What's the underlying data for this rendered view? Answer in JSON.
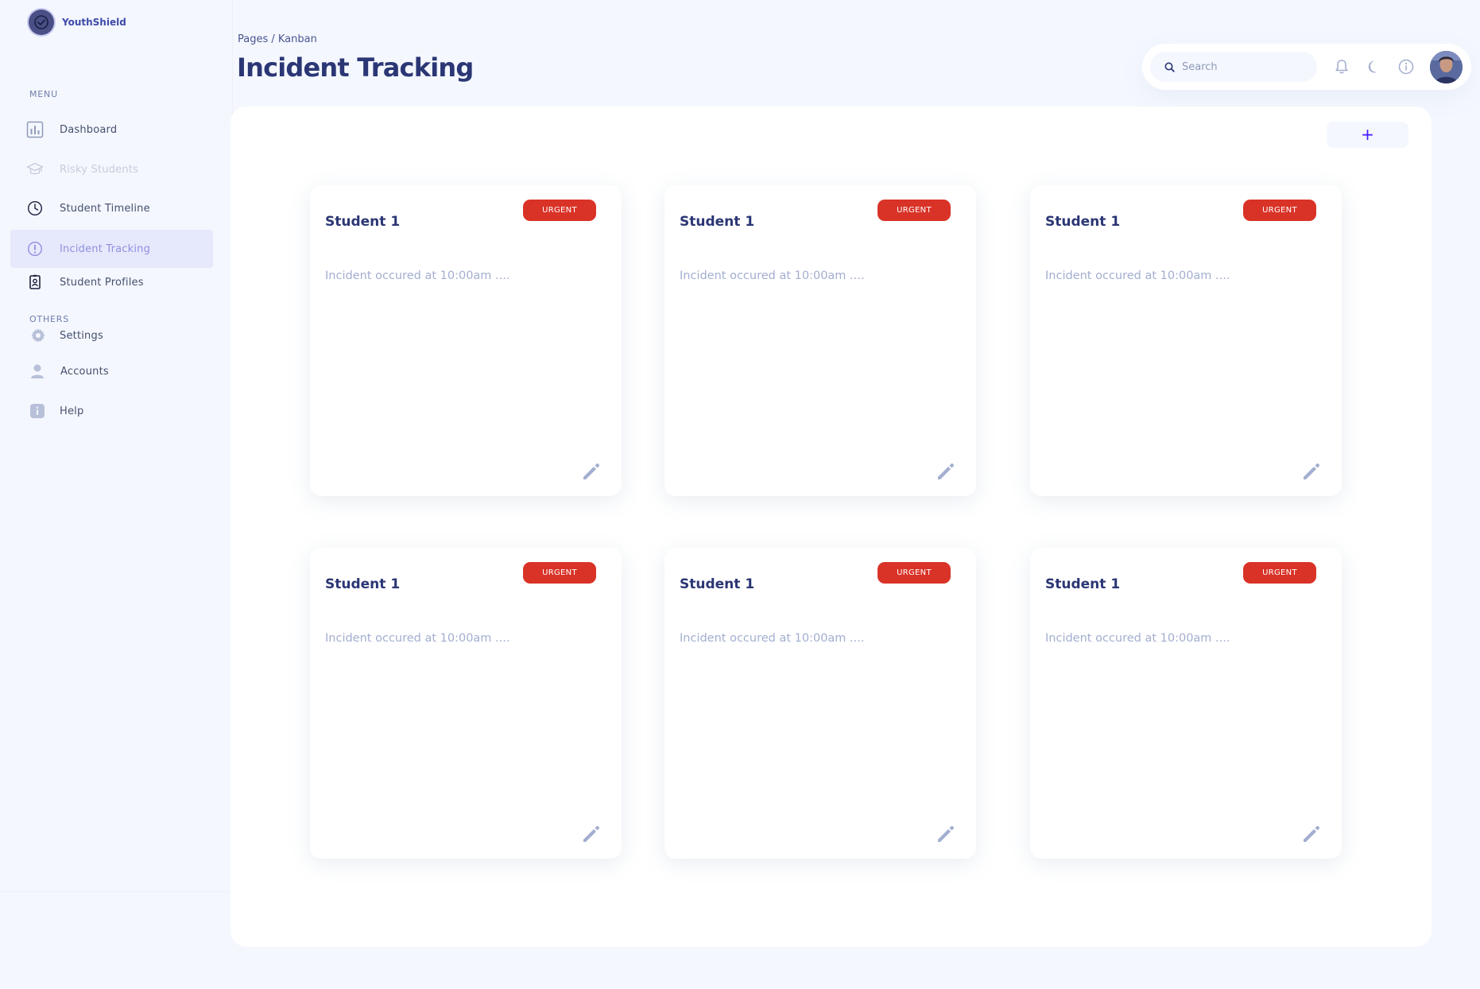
{
  "brand": {
    "name": "YouthShield"
  },
  "sidebar": {
    "menu_label": "MENU",
    "others_label": "OTHERS",
    "items": [
      {
        "label": "Dashboard",
        "icon": "bar-chart-icon",
        "state": "normal"
      },
      {
        "label": "Risky Students",
        "icon": "graduation-cap-icon",
        "state": "disabled"
      },
      {
        "label": "Student Timeline",
        "icon": "clock-icon",
        "state": "normal"
      },
      {
        "label": "Incident Tracking",
        "icon": "alert-icon",
        "state": "active"
      },
      {
        "label": "Student Profiles",
        "icon": "id-badge-icon",
        "state": "normal"
      }
    ],
    "others": [
      {
        "label": "Settings",
        "icon": "gear-icon"
      },
      {
        "label": "Accounts",
        "icon": "user-icon"
      },
      {
        "label": "Help",
        "icon": "info-icon"
      }
    ]
  },
  "header": {
    "breadcrumb": "Pages / Kanban",
    "title": "Incident Tracking"
  },
  "search": {
    "placeholder": "Search",
    "value": ""
  },
  "main": {
    "add_label": "+",
    "cards": [
      {
        "student": "Student 1",
        "badge": "URGENT",
        "text": "Incident occured at 10:00am ...."
      },
      {
        "student": "Student 1",
        "badge": "URGENT",
        "text": "Incident occured at 10:00am ...."
      },
      {
        "student": "Student 1",
        "badge": "URGENT",
        "text": "Incident occured at 10:00am ...."
      },
      {
        "student": "Student 1",
        "badge": "URGENT",
        "text": "Incident occured at 10:00am ...."
      },
      {
        "student": "Student 1",
        "badge": "URGENT",
        "text": "Incident occured at 10:00am ...."
      },
      {
        "student": "Student 1",
        "badge": "URGENT",
        "text": "Incident occured at 10:00am ...."
      }
    ]
  },
  "colors": {
    "accent": "#4318ff",
    "title": "#2b3674",
    "urgent": "#d93328",
    "muted": "#a3aed0",
    "background": "#f4f7fe"
  }
}
